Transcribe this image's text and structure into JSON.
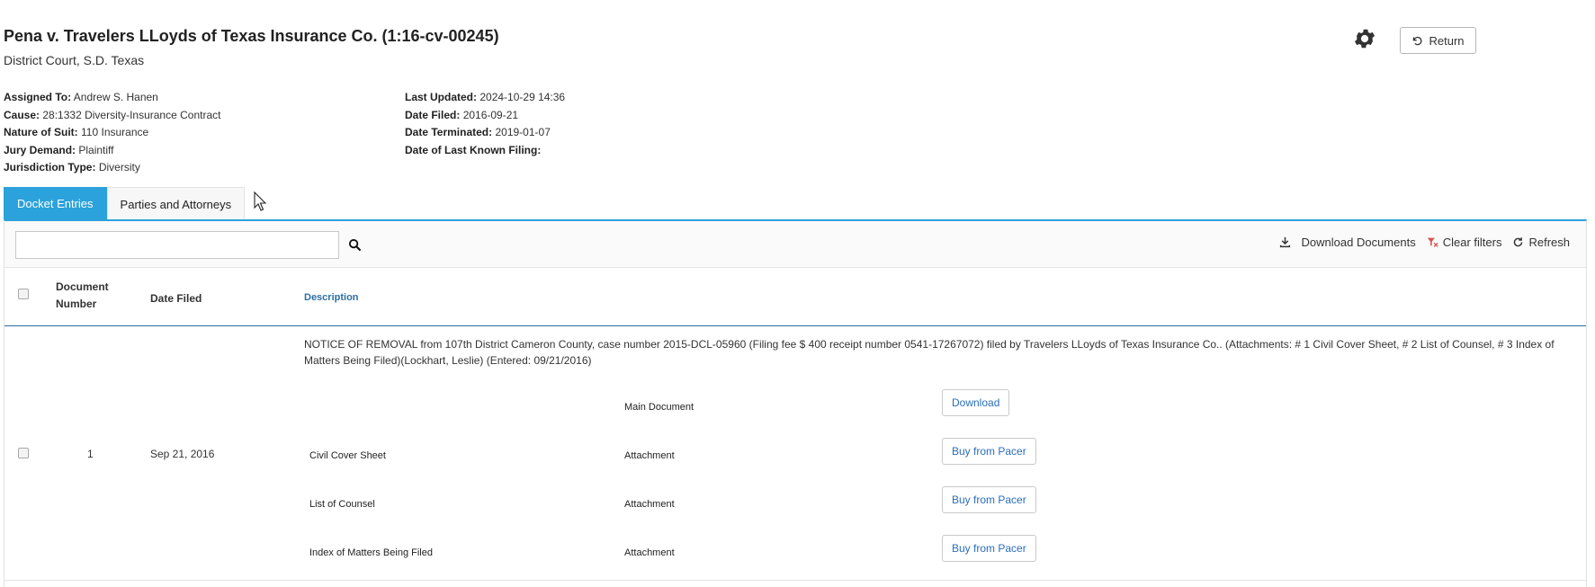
{
  "case": {
    "title": "Pena v. Travelers LLoyds of Texas Insurance Co. (1:16-cv-00245)",
    "court": "District Court, S.D. Texas"
  },
  "header": {
    "settings_icon": "gear-icon",
    "return_label": "Return"
  },
  "meta_left": [
    {
      "key": "Assigned To:",
      "value": "Andrew S. Hanen"
    },
    {
      "key": "Cause:",
      "value": "28:1332 Diversity-Insurance Contract"
    },
    {
      "key": "Nature of Suit:",
      "value": "110 Insurance"
    },
    {
      "key": "Jury Demand:",
      "value": "Plaintiff"
    },
    {
      "key": "Jurisdiction Type:",
      "value": "Diversity"
    }
  ],
  "meta_right": [
    {
      "key": "Last Updated:",
      "value": "2024-10-29 14:36"
    },
    {
      "key": "Date Filed:",
      "value": "2016-09-21"
    },
    {
      "key": "Date Terminated:",
      "value": "2019-01-07"
    },
    {
      "key": "Date of Last Known Filing:",
      "value": ""
    }
  ],
  "tabs": [
    {
      "label": "Docket Entries",
      "active": true
    },
    {
      "label": "Parties and Attorneys",
      "active": false
    }
  ],
  "toolbar": {
    "search_value": "",
    "search_placeholder": "",
    "download_label": "Download Documents",
    "clear_label": "Clear filters",
    "refresh_label": "Refresh"
  },
  "table": {
    "headers": {
      "doc_number_line1": "Document",
      "doc_number_line2": "Number",
      "date_filed": "Date Filed",
      "description": "Description"
    },
    "rows": [
      {
        "number": "1",
        "date": "Sep 21, 2016",
        "description": "NOTICE OF REMOVAL from 107th District Cameron County, case number 2015-DCL-05960 (Filing fee $ 400 receipt number 0541-17267072) filed by Travelers LLoyds of Texas Insurance Co.. (Attachments: # 1 Civil Cover Sheet, # 2 List of Counsel, # 3 Index of Matters Being Filed)(Lockhart, Leslie) (Entered: 09/21/2016)",
        "documents": [
          {
            "name": "",
            "type": "Main Document",
            "action": "Download"
          },
          {
            "name": "Civil Cover Sheet",
            "type": "Attachment",
            "action": "Buy from Pacer"
          },
          {
            "name": "List of Counsel",
            "type": "Attachment",
            "action": "Buy from Pacer"
          },
          {
            "name": "Index of Matters Being Filed",
            "type": "Attachment",
            "action": "Buy from Pacer"
          }
        ]
      }
    ]
  },
  "colors": {
    "accent": "#2ba2db",
    "header_border": "#2b6ea6",
    "link": "#2a6ebb"
  }
}
